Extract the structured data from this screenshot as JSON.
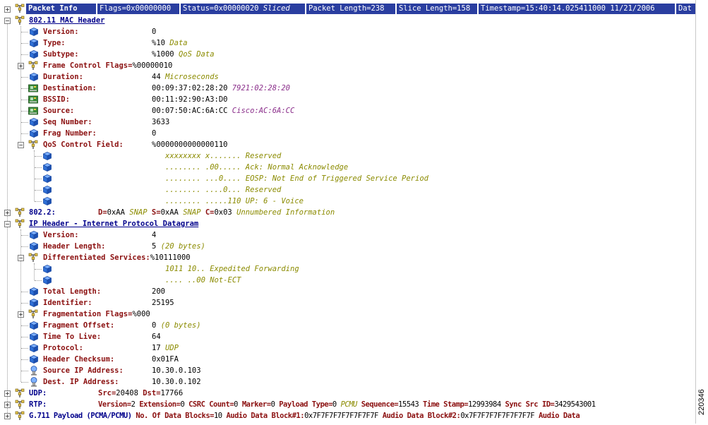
{
  "header": {
    "title": "Packet Info",
    "flags": "Flags=0x00000000",
    "status": "Status=0x00000020",
    "status_note": "Sliced",
    "packet_length": "Packet Length=238",
    "slice_length": "Slice Length=158",
    "timestamp": "Timestamp=15:40:14.025411000 11/21/2006",
    "data": "Dat"
  },
  "mac": {
    "title": "802.11 MAC Header",
    "version": {
      "label": "Version:",
      "value": "0"
    },
    "type": {
      "label": "Type:",
      "value": "%10",
      "note": "Data"
    },
    "subtype": {
      "label": "Subtype:",
      "value": "%1000",
      "note": "QoS Data"
    },
    "fcf": {
      "label": "Frame Control Flags=",
      "value": "%00000010"
    },
    "duration": {
      "label": "Duration:",
      "value": "44",
      "note": "Microseconds"
    },
    "destination": {
      "label": "Destination:",
      "value": "00:09:37:02:28:20",
      "note": "7921:02:28:20"
    },
    "bssid": {
      "label": "BSSID:",
      "value": "00:11:92:90:A3:D0"
    },
    "source": {
      "label": "Source:",
      "value": "00:07:50:AC:6A:CC",
      "note": "Cisco:AC:6A:CC"
    },
    "seq": {
      "label": "Seq Number:",
      "value": "3633"
    },
    "frag": {
      "label": "Frag Number:",
      "value": "0"
    },
    "qos": {
      "label": "QoS Control Field:",
      "value": "%0000000000000110"
    },
    "qos_bits": [
      "xxxxxxxx x....... Reserved",
      "........ .00..... Ack: Normal Acknowledge",
      "........ ...0.... EOSP: Not End of Triggered Service Period",
      "........ ....0... Reserved",
      "........ .....110 UP: 6 - Voice"
    ]
  },
  "llc": {
    "title": "802.2:",
    "d_label": "D=",
    "d_value": "0xAA",
    "d_note": "SNAP",
    "s_label": "S=",
    "s_value": "0xAA",
    "s_note": "SNAP",
    "c_label": "C=",
    "c_value": "0x03",
    "c_note": "Unnumbered Information"
  },
  "ip": {
    "title": "IP Header - Internet Protocol Datagram",
    "version": {
      "label": "Version:",
      "value": "4"
    },
    "hlen": {
      "label": "Header Length:",
      "value": "5",
      "note": "(20 bytes)"
    },
    "diff": {
      "label": "Differentiated Services:",
      "value": "%10111000"
    },
    "diff_bits": [
      "1011 10.. Expedited Forwarding",
      ".... ..00 Not-ECT"
    ],
    "total_length": {
      "label": "Total Length:",
      "value": "200"
    },
    "identifier": {
      "label": "Identifier:",
      "value": "25195"
    },
    "frag_flags": {
      "label": "Fragmentation Flags=",
      "value": "%000"
    },
    "frag_offset": {
      "label": "Fragment Offset:",
      "value": "0",
      "note": "(0 bytes)"
    },
    "ttl": {
      "label": "Time To Live:",
      "value": "64"
    },
    "protocol": {
      "label": "Protocol:",
      "value": "17",
      "note": "UDP"
    },
    "checksum": {
      "label": "Header Checksum:",
      "value": "0x01FA"
    },
    "src_ip": {
      "label": "Source IP Address:",
      "value": "10.30.0.103"
    },
    "dst_ip": {
      "label": "Dest. IP Address:",
      "value": "10.30.0.102"
    }
  },
  "udp": {
    "title": "UDP:",
    "src_label": "Src=",
    "src_value": "20408",
    "dst_label": "Dst=",
    "dst_value": "17766"
  },
  "rtp": {
    "title": "RTP:",
    "version_label": "Version=",
    "version_value": "2",
    "ext_label": "Extension=",
    "ext_value": "0",
    "csrc_label": "CSRC Count=",
    "csrc_value": "0",
    "marker_label": "Marker=",
    "marker_value": "0",
    "ptype_label": "Payload Type=",
    "ptype_value": "0",
    "ptype_note": "PCMU",
    "seq_label": "Sequence=",
    "seq_value": "15543",
    "ts_label": "Time Stamp=",
    "ts_value": "12993984",
    "ssrc_label": "Sync Src ID=",
    "ssrc_value": "3429543001"
  },
  "g711": {
    "title": "G.711 Payload (PCMA/PCMU)",
    "blocks_label": "No. Of Data Blocks=",
    "blocks_value": "10",
    "b1_label": "Audio Data Block#1:",
    "b1_value": "0x7F7F7F7F7F7F7F7F",
    "b2_label": "Audio Data Block#2:",
    "b2_value": "0x7F7F7F7F7F7F7F7F",
    "b3_label": "Audio Data"
  },
  "figure_number": "220346",
  "colors": {
    "header_bg": "#2a3ea0",
    "label": "#8b1010",
    "section": "#00008b",
    "note": "#8b8b00",
    "note_purple": "#8b2f8b"
  }
}
